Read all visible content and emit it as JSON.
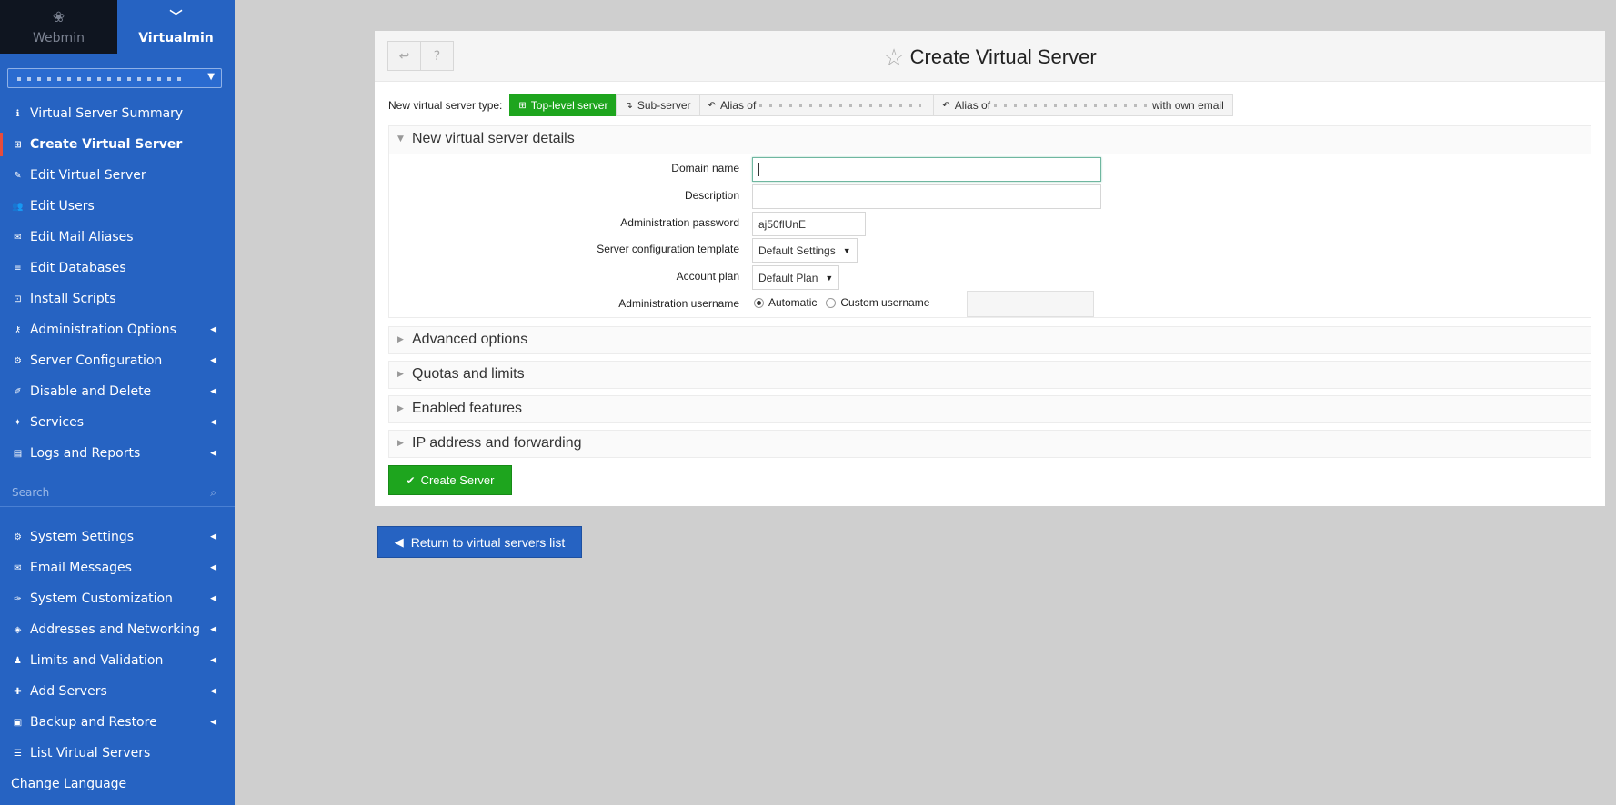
{
  "sidebar": {
    "tabs": [
      {
        "label": "Webmin",
        "icon": "webmin-logo-icon"
      },
      {
        "label": "Virtualmin",
        "icon": "chevron-down-icon"
      }
    ],
    "domain_select_value": "",
    "menu": [
      {
        "label": "Virtual Server Summary",
        "icon": "info-icon",
        "glyph": "ℹ",
        "submenu": false,
        "active": false
      },
      {
        "label": "Create Virtual Server",
        "icon": "plus-square-icon",
        "glyph": "⊞",
        "submenu": false,
        "active": true
      },
      {
        "label": "Edit Virtual Server",
        "icon": "edit-icon",
        "glyph": "✎",
        "submenu": false,
        "active": false
      },
      {
        "label": "Edit Users",
        "icon": "users-icon",
        "glyph": "👥",
        "submenu": false,
        "active": false
      },
      {
        "label": "Edit Mail Aliases",
        "icon": "envelope-icon",
        "glyph": "✉",
        "submenu": false,
        "active": false
      },
      {
        "label": "Edit Databases",
        "icon": "database-icon",
        "glyph": "≡",
        "submenu": false,
        "active": false
      },
      {
        "label": "Install Scripts",
        "icon": "download-box-icon",
        "glyph": "⊡",
        "submenu": false,
        "active": false
      },
      {
        "label": "Administration Options",
        "icon": "key-icon",
        "glyph": "⚷",
        "submenu": true,
        "active": false
      },
      {
        "label": "Server Configuration",
        "icon": "cogs-icon",
        "glyph": "⚙",
        "submenu": true,
        "active": false
      },
      {
        "label": "Disable and Delete",
        "icon": "brush-icon",
        "glyph": "✐",
        "submenu": true,
        "active": false
      },
      {
        "label": "Services",
        "icon": "puzzle-icon",
        "glyph": "✦",
        "submenu": true,
        "active": false
      },
      {
        "label": "Logs and Reports",
        "icon": "file-icon",
        "glyph": "▤",
        "submenu": true,
        "active": false
      }
    ],
    "search_placeholder": "Search",
    "menu2": [
      {
        "label": "System Settings",
        "icon": "gear-icon",
        "glyph": "⚙",
        "submenu": true
      },
      {
        "label": "Email Messages",
        "icon": "envelope-icon",
        "glyph": "✉",
        "submenu": true
      },
      {
        "label": "System Customization",
        "icon": "wrench-icon",
        "glyph": "✑",
        "submenu": true
      },
      {
        "label": "Addresses and Networking",
        "icon": "shield-icon",
        "glyph": "◈",
        "submenu": true
      },
      {
        "label": "Limits and Validation",
        "icon": "user-lock-icon",
        "glyph": "♟",
        "submenu": true
      },
      {
        "label": "Add Servers",
        "icon": "plus-icon",
        "glyph": "✚",
        "submenu": true
      },
      {
        "label": "Backup and Restore",
        "icon": "save-icon",
        "glyph": "▣",
        "submenu": true
      },
      {
        "label": "List Virtual Servers",
        "icon": "list-icon",
        "glyph": "☰",
        "submenu": false
      },
      {
        "label": "Change Language",
        "icon": "",
        "glyph": "",
        "submenu": false
      }
    ]
  },
  "header": {
    "title": "Create Virtual Server",
    "back_icon": "back-arrow-icon",
    "help_icon": "question-circle-icon"
  },
  "server_type": {
    "label": "New virtual server type:",
    "options": [
      {
        "label": "Top-level server",
        "selected": true,
        "icon": "plus-square-icon"
      },
      {
        "label": "Sub-server",
        "selected": false,
        "icon": "level-down-icon"
      },
      {
        "label": "Alias of",
        "selected": false,
        "icon": "reply-icon"
      },
      {
        "label": "Alias of",
        "suffix": "with own email",
        "selected": false,
        "icon": "reply-all-icon"
      }
    ]
  },
  "details": {
    "title": "New virtual server details",
    "fields": {
      "domain_name": {
        "label": "Domain name",
        "value": ""
      },
      "description": {
        "label": "Description",
        "value": ""
      },
      "admin_password": {
        "label": "Administration password",
        "value": "aj50flUnE"
      },
      "template": {
        "label": "Server configuration template",
        "value": "Default Settings"
      },
      "plan": {
        "label": "Account plan",
        "value": "Default Plan"
      },
      "admin_username": {
        "label": "Administration username",
        "option_auto": "Automatic",
        "option_custom": "Custom username",
        "selected": "auto"
      }
    }
  },
  "sections": [
    {
      "title": "Advanced options"
    },
    {
      "title": "Quotas and limits"
    },
    {
      "title": "Enabled features"
    },
    {
      "title": "IP address and forwarding"
    }
  ],
  "buttons": {
    "create": "Create Server",
    "return": "Return to virtual servers list"
  }
}
